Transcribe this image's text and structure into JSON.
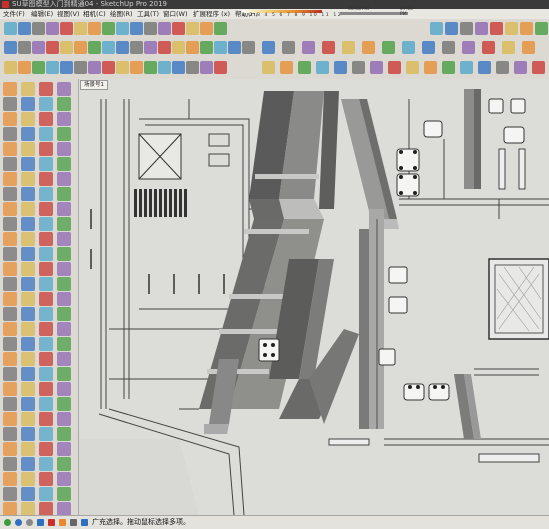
{
  "window": {
    "title": "SU草图模型入门到精通04 - SketchUp Pro 2019"
  },
  "menubar": {
    "items": [
      "文件(F)",
      "编辑(E)",
      "视图(V)",
      "相机(C)",
      "绘图(R)",
      "工具(T)",
      "窗口(W)",
      "扩展程序 (x)",
      "帮助(H)"
    ]
  },
  "shadow": {
    "months": "1 2 3 4 5 6 7 8 9 10 11 12",
    "time_start": "06:38 AM",
    "time_end": "07:00 PM"
  },
  "scene": {
    "tab_label": "场景号1"
  },
  "status": {
    "text": "广充选择。拖动鼠标选择多项。"
  },
  "colors": {
    "accent_orange": "#e8892c",
    "accent_blue": "#2f6fc0",
    "accent_red": "#c9302c",
    "accent_green": "#3f9a3a",
    "viewport_bg": "#d8d8d4"
  },
  "icons": {
    "toolbar_row1": [
      "new-file-icon",
      "open-icon",
      "save-icon",
      "print-icon",
      "undo-icon",
      "redo-icon",
      "cut-icon",
      "copy-icon",
      "erase-icon",
      "camera-icon",
      "orbit-icon",
      "pan-icon",
      "zoom-icon",
      "zoom-window-icon",
      "zoom-extents-icon",
      "previous-view-icon"
    ],
    "toolbar_row2": [
      "select-icon",
      "component-icon",
      "paint-icon",
      "eraser-icon",
      "line-icon",
      "arc-icon",
      "rectangle-icon",
      "circle-icon",
      "push-pull-icon",
      "move-icon",
      "rotate-icon",
      "scale-icon",
      "offset-icon",
      "tape-icon",
      "dimension-icon",
      "text-icon",
      "axes-icon",
      "section-icon"
    ],
    "toolbar_row3": [
      "warehouse-icon",
      "layer-icon",
      "home-icon",
      "iso-view-icon",
      "top-view-icon",
      "front-view-icon",
      "right-view-icon",
      "back-view-icon",
      "left-view-icon",
      "xray-icon",
      "wireframe-icon",
      "hidden-line-icon",
      "shaded-icon",
      "textured-icon",
      "monochrome-icon",
      "fog-icon"
    ]
  }
}
